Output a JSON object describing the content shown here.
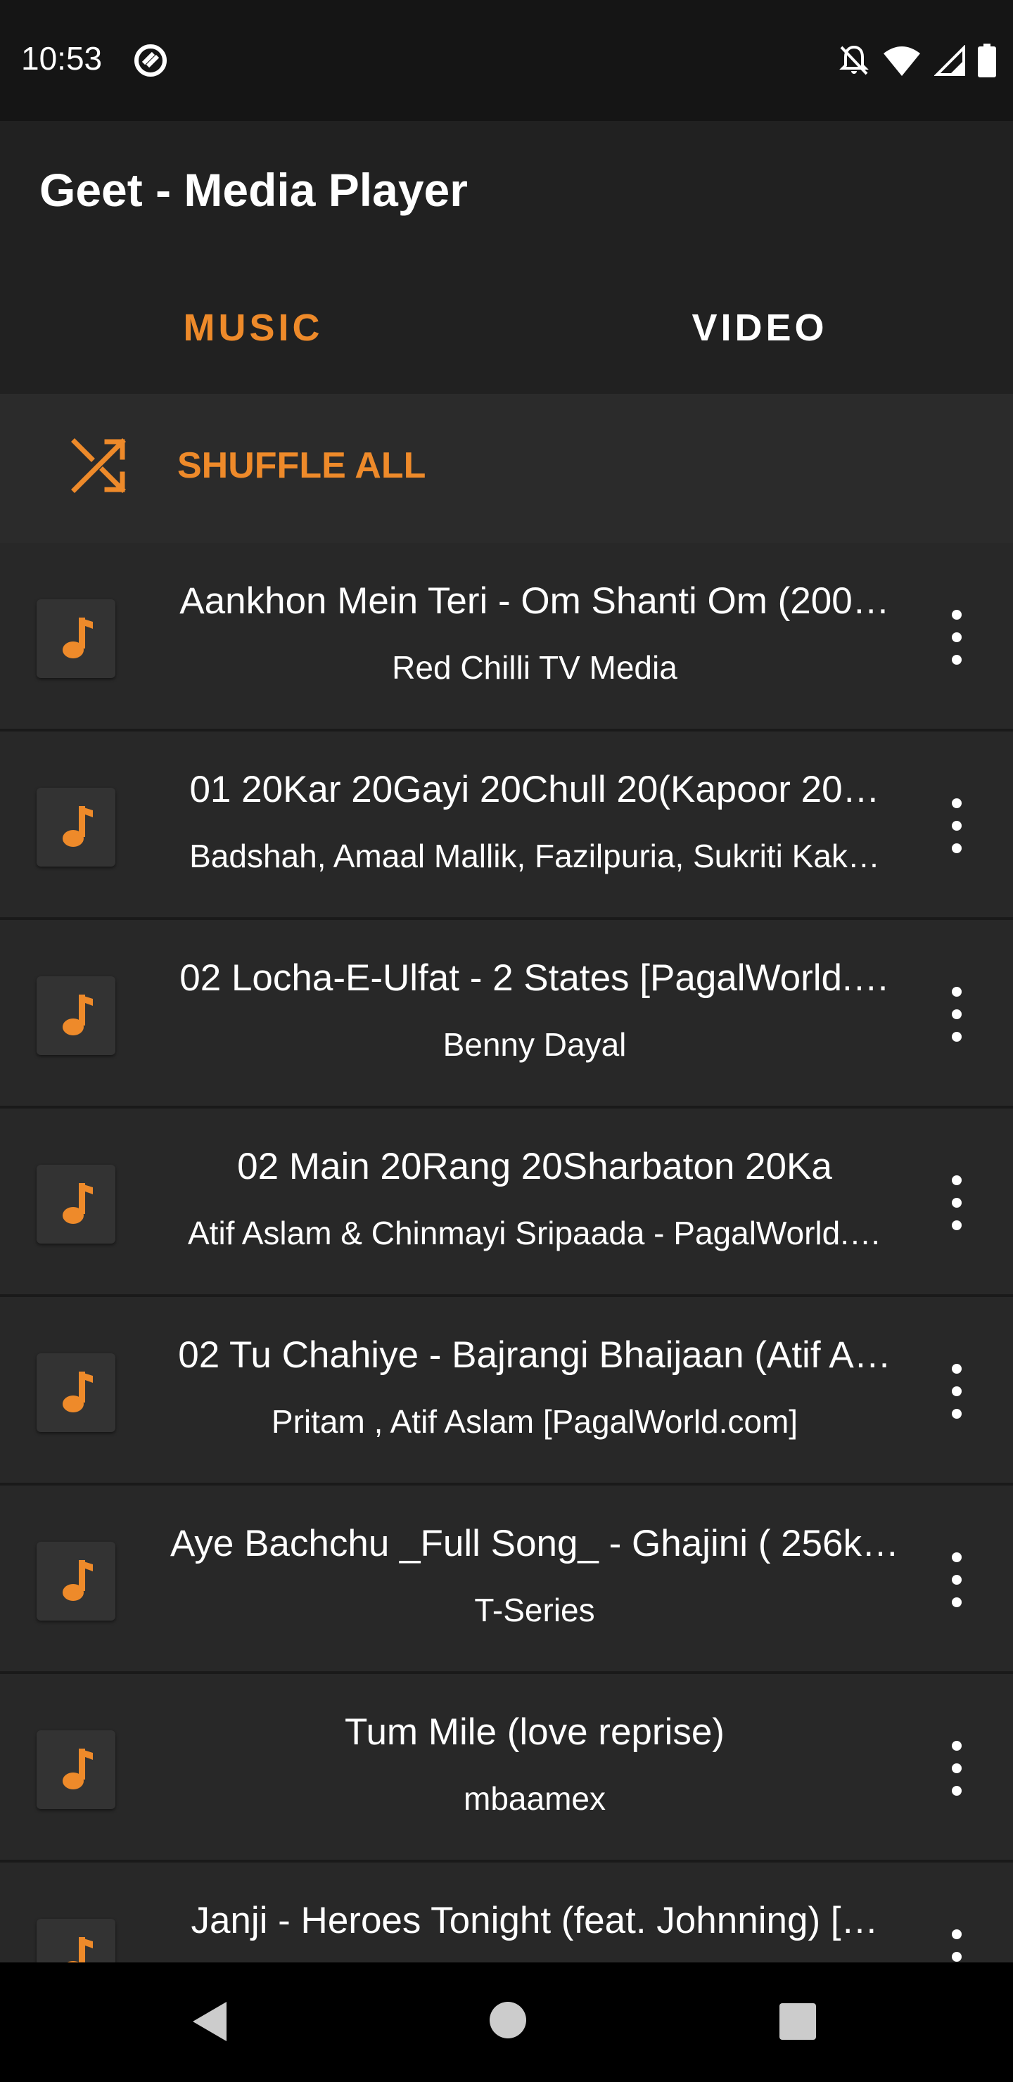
{
  "status_bar": {
    "time": "10:53",
    "icons": [
      "sync-icon",
      "notifications-off-icon",
      "wifi-icon",
      "signal-icon",
      "battery-icon"
    ]
  },
  "app_bar": {
    "title": "Geet - Media Player"
  },
  "tabs": [
    {
      "label": "MUSIC",
      "selected": true
    },
    {
      "label": "VIDEO",
      "selected": false
    }
  ],
  "shuffle": {
    "label": "SHUFFLE ALL",
    "icon": "shuffle-icon"
  },
  "songs": [
    {
      "title": "Aankhon Mein Teri - Om Shanti Om (200…",
      "artist": "Red Chilli TV Media"
    },
    {
      "title": "01 20Kar 20Gayi 20Chull 20(Kapoor 20…",
      "artist": "Badshah, Amaal Mallik, Fazilpuria, Sukriti Kak…"
    },
    {
      "title": "02 Locha-E-Ulfat - 2 States [PagalWorld.…",
      "artist": "Benny Dayal"
    },
    {
      "title": "02 Main 20Rang 20Sharbaton 20Ka",
      "artist": "Atif Aslam & Chinmayi Sripaada - PagalWorld.…"
    },
    {
      "title": "02 Tu Chahiye  - Bajrangi Bhaijaan (Atif A…",
      "artist": "Pritam , Atif Aslam  [PagalWorld.com]"
    },
    {
      "title": "Aye Bachchu _Full Song_ - Ghajini ( 256k…",
      "artist": "T-Series"
    },
    {
      "title": "Tum  Mile (love reprise)",
      "artist": "mbaamex"
    },
    {
      "title": "Janji - Heroes Tonight (feat. Johnning) […",
      "artist": ""
    }
  ],
  "colors": {
    "accent": "#ee8a2a",
    "background": "#282828",
    "app_bar": "#212121",
    "status_bar": "#151515"
  },
  "nav_bar": {
    "icons": [
      "back-icon",
      "home-icon",
      "recents-icon"
    ]
  }
}
